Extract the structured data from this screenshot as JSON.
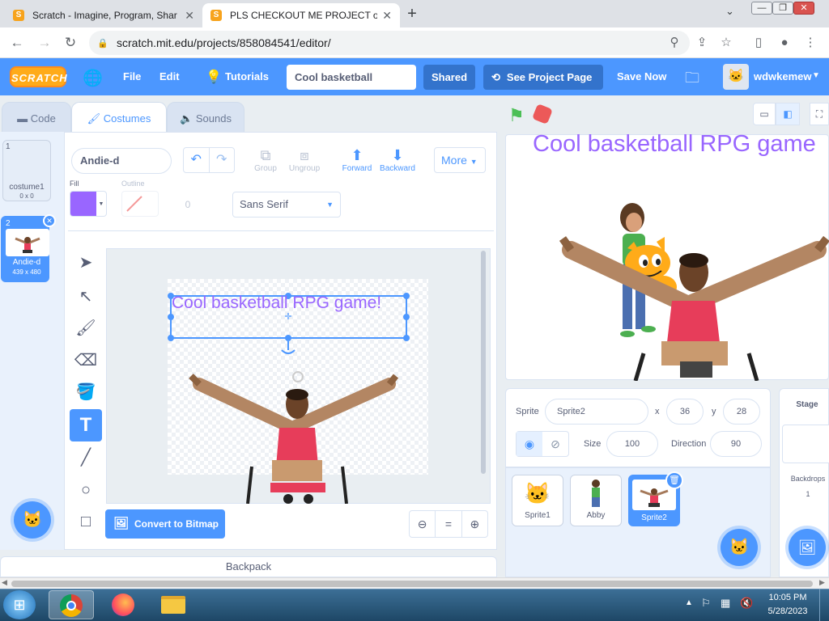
{
  "browser": {
    "tabs": [
      {
        "title": "Scratch - Imagine, Program, Shar",
        "active": false
      },
      {
        "title": "PLS CHECKOUT ME PROJECT on",
        "active": true
      }
    ],
    "url": "scratch.mit.edu/projects/858084541/editor/"
  },
  "menubar": {
    "logo": "SCRATCH",
    "file": "File",
    "edit": "Edit",
    "tutorials": "Tutorials",
    "project_title": "Cool basketball",
    "shared": "Shared",
    "see_project_page": "See Project Page",
    "save_now": "Save Now",
    "username": "wdwkemew"
  },
  "editor_tabs": {
    "code": "Code",
    "costumes": "Costumes",
    "sounds": "Sounds"
  },
  "costumes": [
    {
      "num": "1",
      "name": "costume1",
      "size": "0 x 0"
    },
    {
      "num": "2",
      "name": "Andie-d",
      "size": "439 x 480"
    }
  ],
  "paint": {
    "costume_name": "Andie-d",
    "group": "Group",
    "ungroup": "Ungroup",
    "forward": "Forward",
    "backward": "Backward",
    "more": "More",
    "fill_label": "Fill",
    "outline_label": "Outline",
    "outline_width": "0",
    "font": "Sans Serif",
    "canvas_text": "Cool basketball RPG game!",
    "convert": "Convert to Bitmap",
    "zoom_reset": "="
  },
  "backpack": "Backpack",
  "stage": {
    "title_text": "Cool basketball RPG game"
  },
  "sprite_info": {
    "sprite_label": "Sprite",
    "sprite_name": "Sprite2",
    "x_label": "x",
    "x": "36",
    "y_label": "y",
    "y": "28",
    "size_label": "Size",
    "size": "100",
    "direction_label": "Direction",
    "direction": "90"
  },
  "sprites": [
    {
      "name": "Sprite1"
    },
    {
      "name": "Abby"
    },
    {
      "name": "Sprite2"
    }
  ],
  "stage_panel": {
    "label": "Stage",
    "backdrops_label": "Backdrops",
    "backdrops_count": "1"
  },
  "clock": {
    "time": "10:05 PM",
    "date": "5/28/2023"
  },
  "colors": {
    "scratch_blue": "#4c97ff",
    "fill": "#9966ff",
    "menubar": "#4c97ff"
  }
}
